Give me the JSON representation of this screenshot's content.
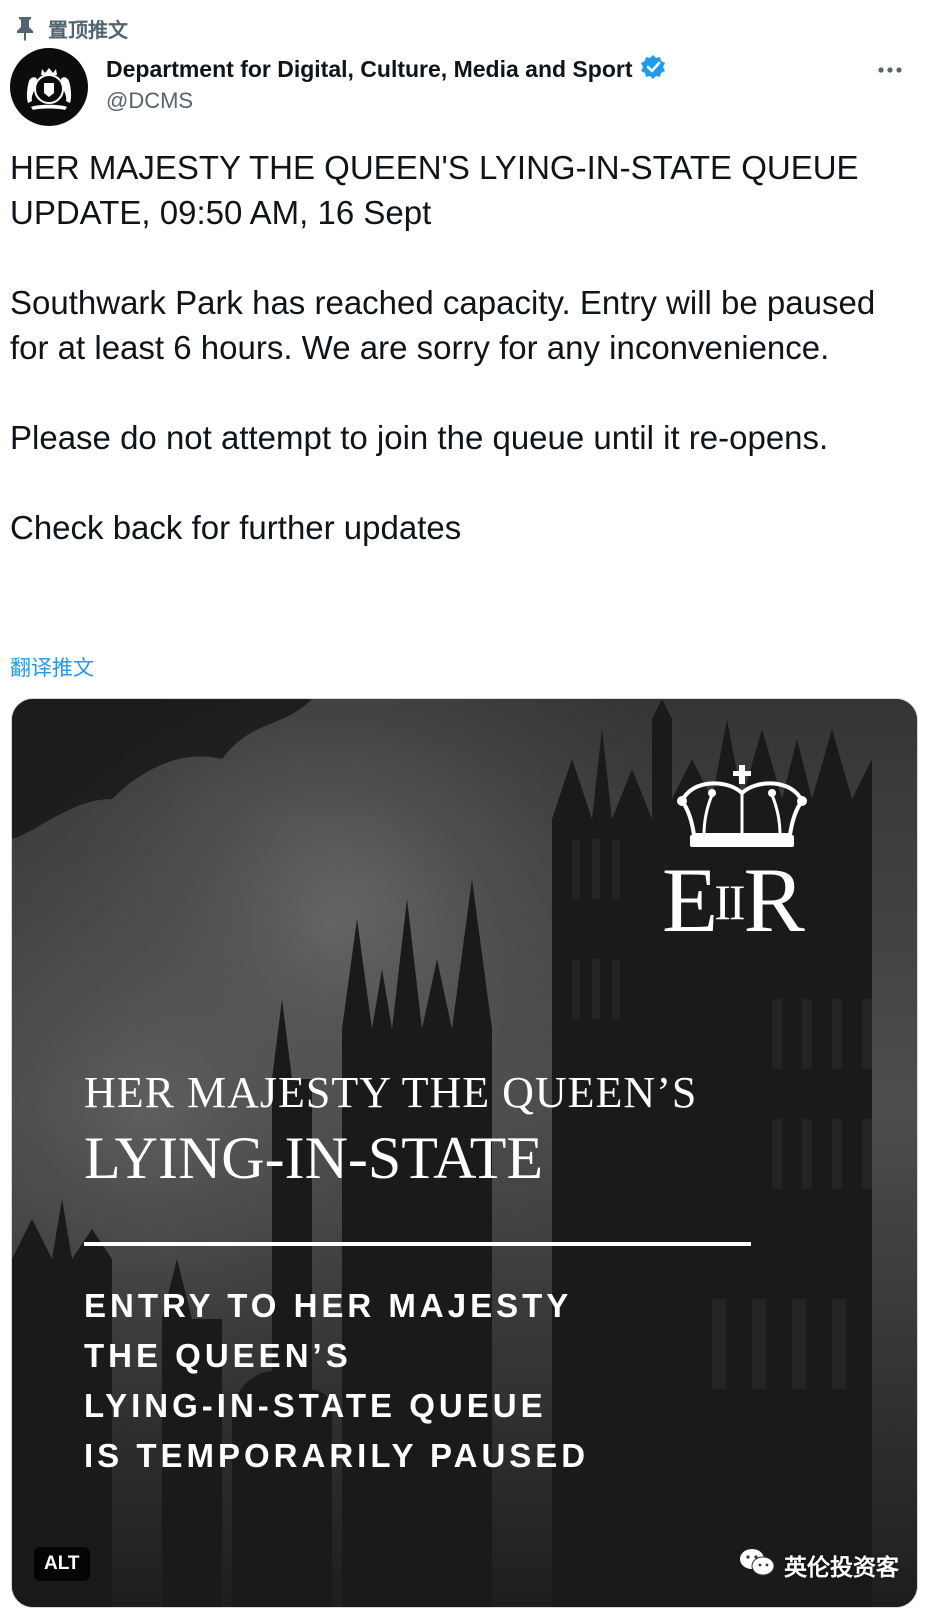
{
  "pinned": {
    "label": "置顶推文",
    "icon": "pin-icon"
  },
  "author": {
    "name": "Department for Digital, Culture, Media and Sport",
    "handle": "@DCMS",
    "verified_icon": "verified-badge-icon",
    "avatar_icon": "royal-coat-of-arms",
    "more_icon": "more-options-icon"
  },
  "tweet": {
    "paragraphs": [
      "HER MAJESTY THE QUEEN'S LYING-IN-STATE QUEUE UPDATE, 09:50 AM, 16 Sept",
      "Southwark Park has reached capacity. Entry will be paused for at least 6 hours. We are sorry for any inconvenience.",
      "Please do not attempt to join the queue until it re-opens.",
      "Check back for further updates"
    ],
    "translate_link": "翻译推文"
  },
  "media": {
    "cypher_left": "E",
    "cypher_mid": "II",
    "cypher_right": "R",
    "title_line1": "HER MAJESTY THE QUEEN’S",
    "title_line2": "LYING-IN-STATE",
    "notice_lines": [
      "ENTRY TO HER MAJESTY",
      "THE QUEEN’S",
      "LYING-IN-STATE QUEUE",
      "IS TEMPORARILY PAUSED"
    ],
    "alt_label": "ALT",
    "watermark": "英伦投资客",
    "watermark_icon": "wechat-icon"
  },
  "colors": {
    "text": "#0f1419",
    "secondary": "#536471",
    "link": "#1d9bf0",
    "verified": "#1d9bf0"
  }
}
